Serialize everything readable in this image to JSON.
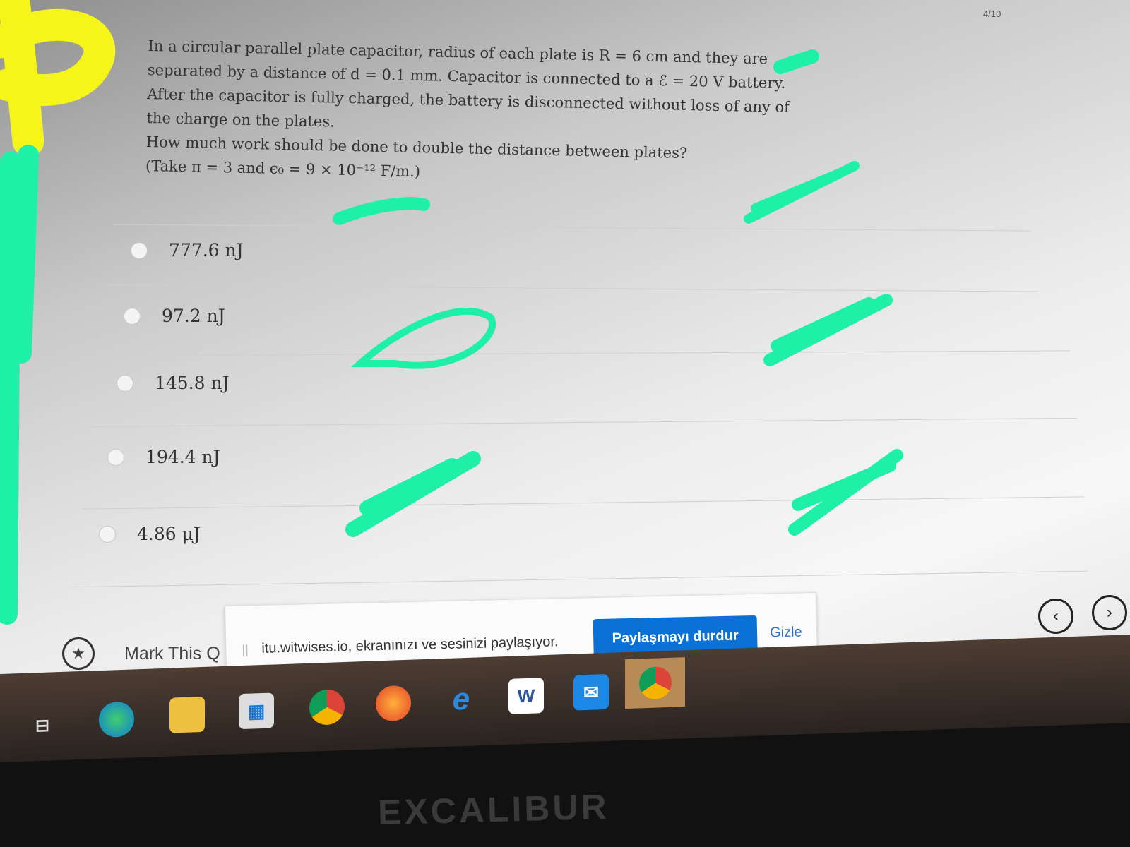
{
  "header": {
    "question_counter": "4/10"
  },
  "question": {
    "paragraph1": "In a circular parallel plate capacitor, radius of each plate is R = 6 cm and they are separated by a distance of d = 0.1 mm. Capacitor is connected to a ℰ = 20 V battery. After the capacitor is fully charged, the battery is disconnected without loss of any of the charge on the plates.",
    "paragraph2": "How much work should be done to double the distance between plates?",
    "paragraph3": "(Take π = 3 and ϵ₀ = 9 × 10⁻¹² F/m.)"
  },
  "options": [
    {
      "label": "777.6 nJ"
    },
    {
      "label": "97.2 nJ"
    },
    {
      "label": "145.8 nJ"
    },
    {
      "label": "194.4 nJ"
    },
    {
      "label": "4.86 μJ"
    }
  ],
  "footer": {
    "mark_label": "Mark This Q",
    "prev_icon": "chevron-left-icon",
    "next_icon": "chevron-right-icon"
  },
  "share_bar": {
    "message": "itu.witwises.io, ekranınızı ve sesinizi paylaşıyor.",
    "stop_button": "Paylaşmayı durdur",
    "hide_link": "Gizle"
  },
  "taskbar": {
    "icons": [
      "task-view-icon",
      "edge-icon",
      "file-explorer-icon",
      "store-icon",
      "chrome-icon",
      "firefox-icon",
      "internet-explorer-icon",
      "word-icon",
      "mail-icon",
      "chrome-icon"
    ]
  },
  "bezel": {
    "brand": "EXCALIBUR"
  },
  "colors": {
    "accent": "#0a72d6",
    "scribble_green": "#1ff0a8",
    "scribble_yellow": "#f5f51a"
  }
}
